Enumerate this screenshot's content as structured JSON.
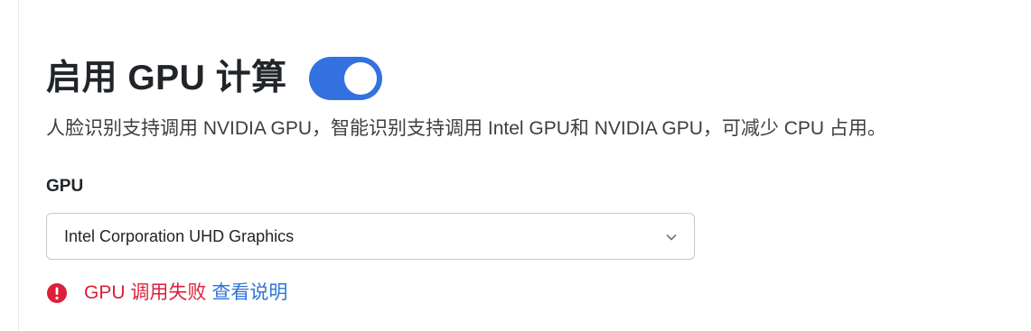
{
  "gpu_settings": {
    "title": "启用 GPU 计算",
    "toggle_enabled": true,
    "description": "人脸识别支持调用 NVIDIA GPU，智能识别支持调用 Intel GPU和 NVIDIA GPU，可减少 CPU 占用。",
    "gpu_field_label": "GPU",
    "gpu_selected": "Intel Corporation UHD Graphics",
    "error_message": "GPU 调用失败",
    "help_link": "查看说明",
    "icons": {
      "error": "error-circle-icon",
      "dropdown": "chevron-down-icon"
    },
    "colors": {
      "accent": "#3471e0",
      "error": "#dc1f3a",
      "link": "#2f74d6"
    }
  }
}
